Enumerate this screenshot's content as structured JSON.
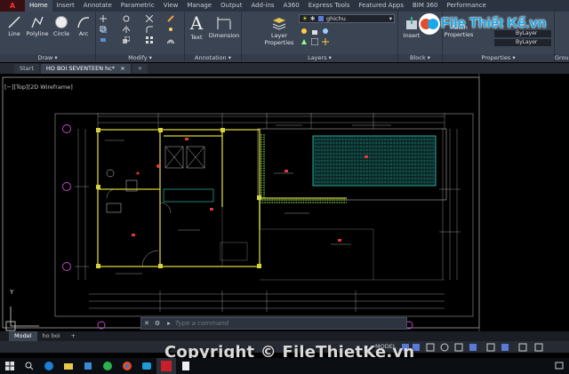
{
  "app": {
    "logo_text": "A"
  },
  "ribbon_tabs": [
    "Home",
    "Insert",
    "Annotate",
    "Parametric",
    "View",
    "Manage",
    "Output",
    "Add-ins",
    "A360",
    "Express Tools",
    "Featured Apps",
    "BIM 360",
    "Performance"
  ],
  "ribbon_groups": {
    "draw": {
      "label": "Draw ▾",
      "tools": [
        "Line",
        "Polyline",
        "Circle",
        "Arc"
      ]
    },
    "modify": {
      "label": "Modify ▾"
    },
    "annotation": {
      "label": "Annotation ▾",
      "tools": [
        "Text",
        "Dimension"
      ]
    },
    "layers": {
      "label": "Layers ▾",
      "properties_label": "Layer Properties",
      "current_layer": "ghichu"
    },
    "block": {
      "label": "Block ▾",
      "insert_label": "Insert"
    },
    "properties": {
      "label": "Properties ▾",
      "match_label": "Match Properties",
      "bylayer_1": "ByLayer",
      "bylayer_2": "ByLayer"
    },
    "groups": {
      "label": "Group"
    }
  },
  "file_tabs": {
    "start": "Start",
    "active": "HO BOI SEVENTEEN hc*",
    "close": "×",
    "add": "+"
  },
  "viewport_label": "[−][Top][2D Wireframe]",
  "command_line": {
    "placeholder": "Type a command"
  },
  "layout_tabs": [
    "Model",
    "ho boi"
  ],
  "layout_add": "+",
  "status": {
    "model": "MODEL"
  },
  "watermarks": {
    "copyright": "Copyright © FileThietKe.vn",
    "logo": "File Thiết Kế.vn"
  },
  "colors": {
    "ribbon_bg": "#3b4453",
    "canvas_bg": "#000000",
    "wall_yellow": "#d8d23a",
    "pool_cyan": "#2fd3c0",
    "grass_green": "#8be04a",
    "axis_magenta": "#c84ad0"
  }
}
